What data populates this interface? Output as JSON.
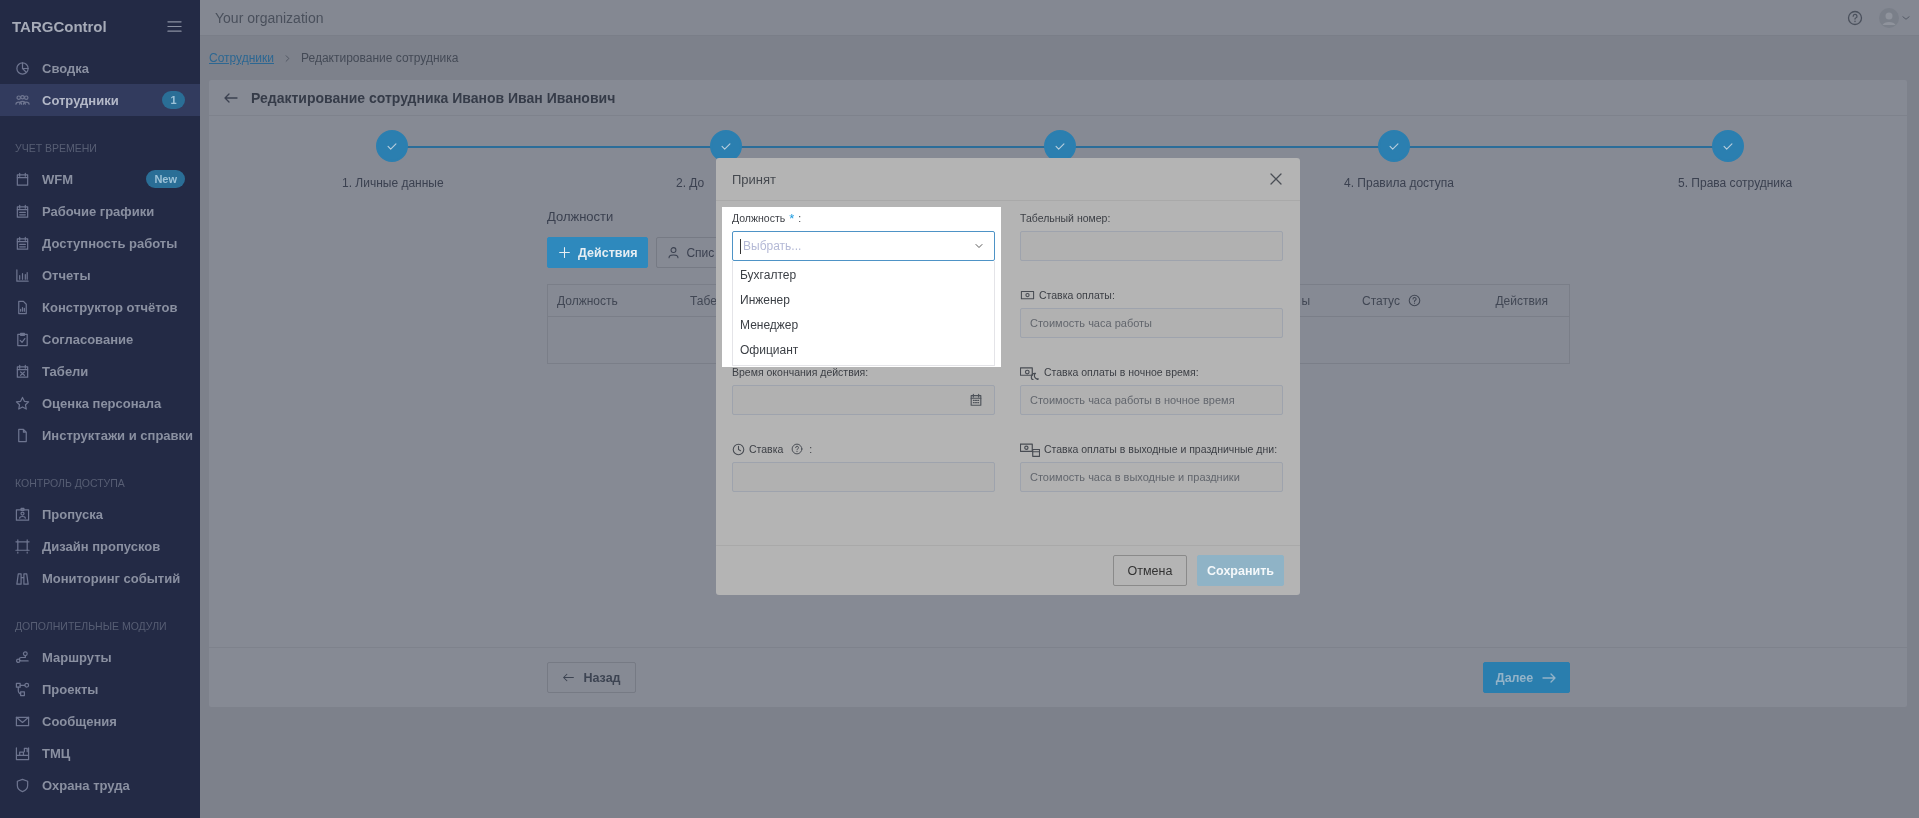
{
  "sidebar": {
    "logo": "TARGControl",
    "sections": [
      {
        "items": [
          {
            "label": "Сводка",
            "selected": false
          },
          {
            "label": "Сотрудники",
            "selected": true,
            "badge": "1"
          }
        ]
      },
      {
        "title": "УЧЕТ ВРЕМЕНИ",
        "items": [
          {
            "label": "WFM",
            "selected": false,
            "badge": "New"
          },
          {
            "label": "Рабочие графики",
            "selected": false
          },
          {
            "label": "Доступность работы",
            "selected": false
          },
          {
            "label": "Отчеты",
            "selected": false
          },
          {
            "label": "Конструктор отчётов",
            "selected": false
          },
          {
            "label": "Согласование",
            "selected": false
          },
          {
            "label": "Табели",
            "selected": false
          },
          {
            "label": "Оценка персонала",
            "selected": false
          },
          {
            "label": "Инструктажи и справки",
            "selected": false
          }
        ]
      },
      {
        "title": "КОНТРОЛЬ ДОСТУПА",
        "items": [
          {
            "label": "Пропуска",
            "selected": false
          },
          {
            "label": "Дизайн пропусков",
            "selected": false
          },
          {
            "label": "Мониторинг событий",
            "selected": false
          }
        ]
      },
      {
        "title": "ДОПОЛНИТЕЛЬНЫЕ МОДУЛИ",
        "items": [
          {
            "label": "Маршруты",
            "selected": false
          },
          {
            "label": "Проекты",
            "selected": false
          },
          {
            "label": "Сообщения",
            "selected": false
          },
          {
            "label": "ТМЦ",
            "selected": false
          },
          {
            "label": "Охрана труда",
            "selected": false
          }
        ]
      }
    ]
  },
  "topbar": {
    "organization": "Your organization"
  },
  "breadcrumbs": [
    {
      "label": "Сотрудники",
      "link": true
    },
    {
      "label": "Редактирование сотрудника",
      "link": false
    }
  ],
  "page": {
    "title": "Редактирование сотрудника Иванов Иван Иванович"
  },
  "steps": [
    {
      "label": "1. Личные данные",
      "done": true
    },
    {
      "label": "2. До",
      "done": true
    },
    {
      "done": true
    },
    {
      "label": "4. Правила доступа",
      "done": true
    },
    {
      "label": "5. Права сотрудника",
      "done": true
    }
  ],
  "positions": {
    "title": "Должности",
    "buttons": [
      {
        "label": "Действия",
        "kind": "primary"
      },
      {
        "label": "Спис",
        "kind": "secondary"
      }
    ],
    "columns": [
      {
        "label": "Должность",
        "help": false
      },
      {
        "label": "Табе",
        "help": false
      },
      {
        "label": "ы",
        "help": false
      },
      {
        "label": "Статус",
        "help": true
      },
      {
        "label": "Действия",
        "help": false
      }
    ]
  },
  "footer_buttons": [
    {
      "label": "Назад",
      "kind": "back"
    },
    {
      "label": "Далее",
      "kind": "next"
    }
  ],
  "dialog": {
    "title": "Принят",
    "position_field": {
      "label": "Должность",
      "required_mark": "*",
      "suffix": ":",
      "placeholder": "Выбрать...",
      "expanded": true,
      "options": [
        "Бухгалтер",
        "Инженер",
        "Менеджер",
        "Официант"
      ]
    },
    "left_fields": [
      {
        "kind": "hidden"
      },
      {
        "kind": "date",
        "label": "Время окончания действия:"
      },
      {
        "kind": "rate",
        "label": "Ставка",
        "suffix": ":",
        "help": true
      }
    ],
    "right_fields": [
      {
        "kind": "text",
        "label": "Табельный номер:"
      },
      {
        "kind": "money",
        "label": "Ставка оплаты:",
        "placeholder": "Стоимость часа работы"
      },
      {
        "kind": "night",
        "label": "Ставка оплаты в ночное время:",
        "placeholder": "Стоимость часа работы в ночное время"
      },
      {
        "kind": "holiday",
        "label": "Ставка оплаты в выходные и праздничные дни:",
        "placeholder": "Стоимость часа в выходные и праздники"
      }
    ],
    "buttons": [
      {
        "label": "Отмена",
        "kind": "secondary",
        "disabled": false
      },
      {
        "label": "Сохранить",
        "kind": "primary",
        "disabled": true
      }
    ]
  }
}
